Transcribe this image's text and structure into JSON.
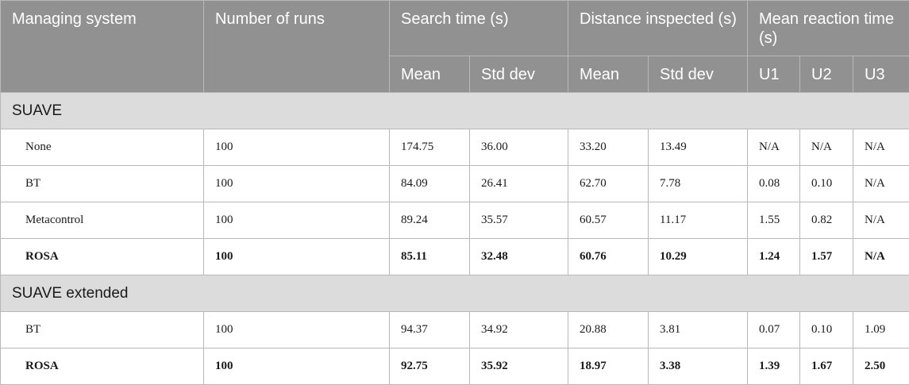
{
  "header": {
    "managing_system": "Managing system",
    "number_of_runs": "Number of runs",
    "search_time": "Search time (s)",
    "distance_inspected": "Distance inspected (s)",
    "mean_reaction_time": "Mean reaction time (s)",
    "mean": "Mean",
    "std_dev": "Std dev",
    "u1": "U1",
    "u2": "U2",
    "u3": "U3"
  },
  "sections": [
    {
      "title": "SUAVE",
      "rows": [
        {
          "system": "None",
          "runs": "100",
          "search_mean": "174.75",
          "search_std": "36.00",
          "dist_mean": "33.20",
          "dist_std": "13.49",
          "u1": "N/A",
          "u2": "N/A",
          "u3": "N/A"
        },
        {
          "system": "BT",
          "runs": "100",
          "search_mean": "84.09",
          "search_std": "26.41",
          "dist_mean": "62.70",
          "dist_std": "7.78",
          "u1": "0.08",
          "u2": "0.10",
          "u3": "N/A"
        },
        {
          "system": "Metacontrol",
          "runs": "100",
          "search_mean": "89.24",
          "search_std": "35.57",
          "dist_mean": "60.57",
          "dist_std": "11.17",
          "u1": "1.55",
          "u2": "0.82",
          "u3": "N/A"
        },
        {
          "system": "ROSA",
          "runs": "100",
          "search_mean": "85.11",
          "search_std": "32.48",
          "dist_mean": "60.76",
          "dist_std": "10.29",
          "u1": "1.24",
          "u2": "1.57",
          "u3": "N/A"
        }
      ]
    },
    {
      "title": "SUAVE extended",
      "rows": [
        {
          "system": "BT",
          "runs": "100",
          "search_mean": "94.37",
          "search_std": "34.92",
          "dist_mean": "20.88",
          "dist_std": "3.81",
          "u1": "0.07",
          "u2": "0.10",
          "u3": "1.09"
        },
        {
          "system": "ROSA",
          "runs": "100",
          "search_mean": "92.75",
          "search_std": "35.92",
          "dist_mean": "18.97",
          "dist_std": "3.38",
          "u1": "1.39",
          "u2": "1.67",
          "u3": "2.50"
        }
      ]
    }
  ]
}
